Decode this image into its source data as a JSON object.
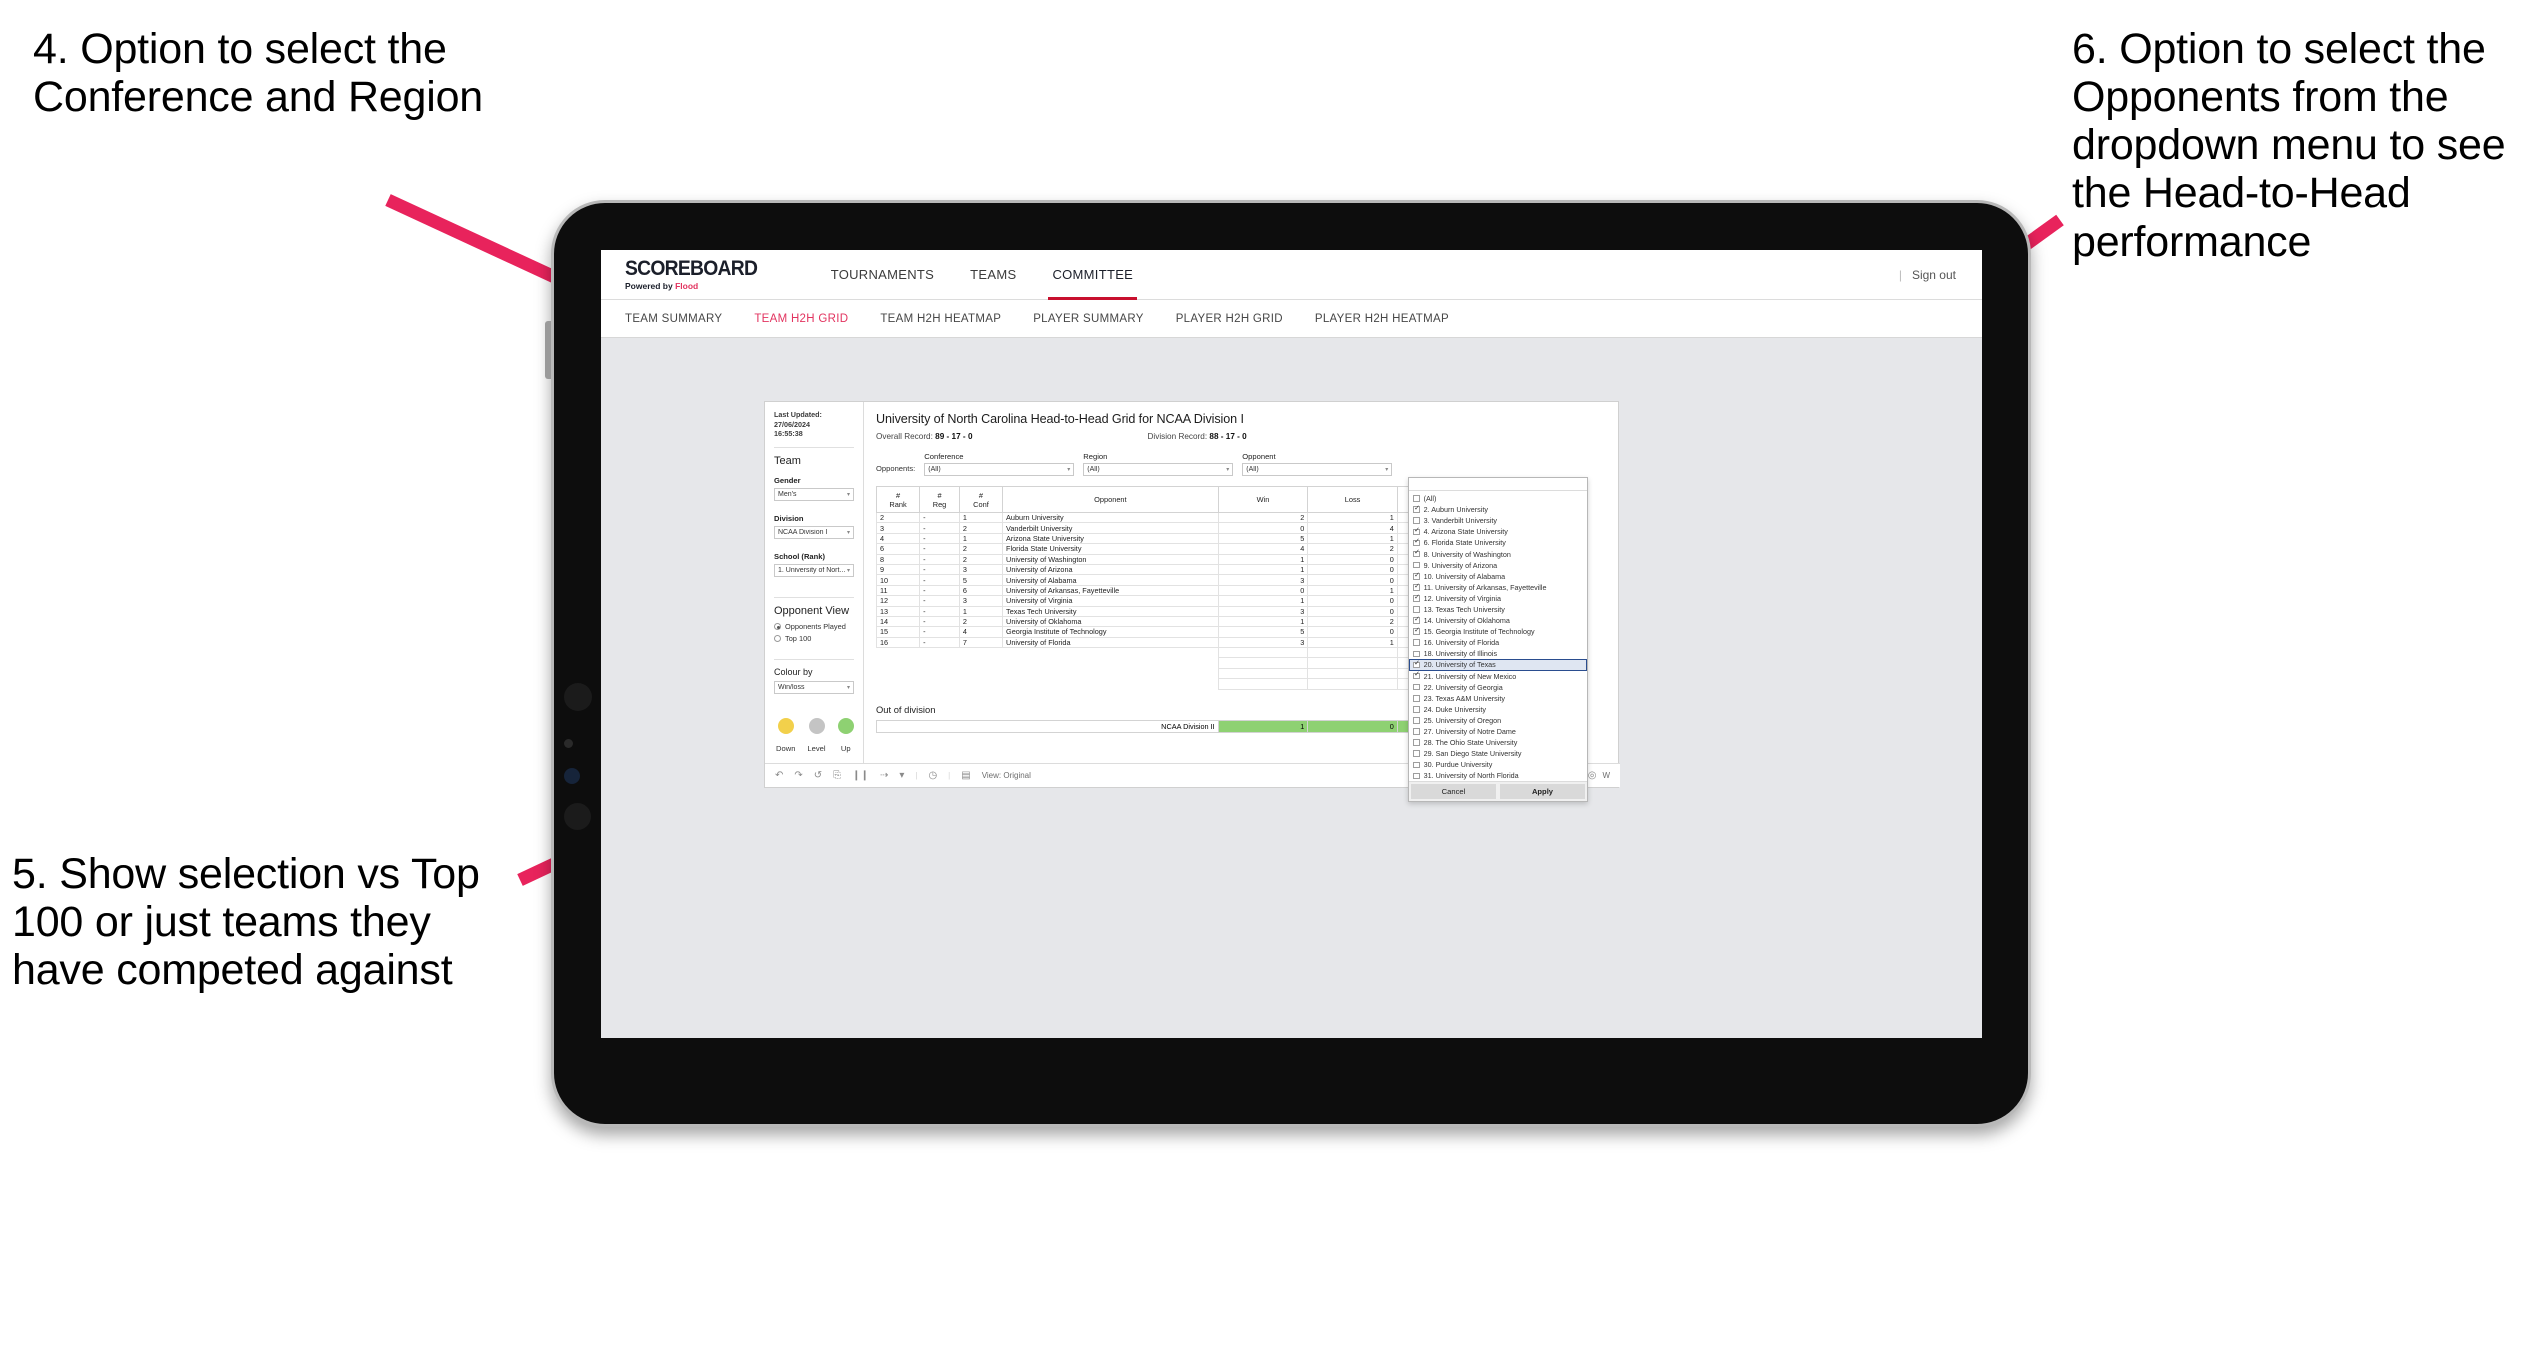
{
  "annotations": [
    {
      "id": "a4",
      "text": "4. Option to select the Conference and Region"
    },
    {
      "id": "a5",
      "text": "5. Show selection vs Top 100 or just teams they have competed against"
    },
    {
      "id": "a6",
      "text": "6. Option to select the Opponents from the dropdown menu to see the Head-to-Head performance"
    }
  ],
  "arrow_color": "#E8235C",
  "app": {
    "brand": {
      "title": "SCOREBOARD",
      "sub_prefix": "Powered by",
      "sub_brand": "Flood"
    },
    "topnav": [
      {
        "label": "TOURNAMENTS",
        "active": false
      },
      {
        "label": "TEAMS",
        "active": false
      },
      {
        "label": "COMMITTEE",
        "active": true
      }
    ],
    "topbar_right": {
      "divider": "|",
      "signout": "Sign out"
    },
    "subnav": [
      {
        "label": "TEAM SUMMARY",
        "active": false
      },
      {
        "label": "TEAM H2H GRID",
        "active": true
      },
      {
        "label": "TEAM H2H HEATMAP",
        "active": false
      },
      {
        "label": "PLAYER SUMMARY",
        "active": false
      },
      {
        "label": "PLAYER H2H GRID",
        "active": false
      },
      {
        "label": "PLAYER H2H HEATMAP",
        "active": false
      }
    ]
  },
  "sidebar": {
    "last_updated": "Last Updated: 27/06/2024",
    "last_updated_time": "16:55:38",
    "team_heading": "Team",
    "gender": {
      "label": "Gender",
      "value": "Men's"
    },
    "division": {
      "label": "Division",
      "value": "NCAA Division I"
    },
    "school": {
      "label": "School (Rank)",
      "value": "1. University of Nort..."
    },
    "opponent_view": {
      "heading": "Opponent View",
      "options": [
        {
          "label": "Opponents Played",
          "selected": true
        },
        {
          "label": "Top 100",
          "selected": false
        }
      ]
    },
    "colour_by": {
      "label": "Colour by",
      "value": "Win/loss"
    },
    "legend": [
      {
        "label": "Down",
        "color": "#F2D04B"
      },
      {
        "label": "Level",
        "color": "#C4C4C4"
      },
      {
        "label": "Up",
        "color": "#8ED172"
      }
    ]
  },
  "sheet": {
    "title": "University of North Carolina Head-to-Head Grid for NCAA Division I",
    "overall_record_label": "Overall Record:",
    "overall_record": "89 - 17 - 0",
    "division_record_label": "Division Record:",
    "division_record": "88 - 17 - 0",
    "opponents_label": "Opponents:",
    "filters": [
      {
        "caption": "Conference",
        "value": "(All)"
      },
      {
        "caption": "Region",
        "value": "(All)"
      },
      {
        "caption": "Opponent",
        "value": "(All)"
      }
    ],
    "columns": [
      "# Rank",
      "# Reg",
      "# Conf",
      "Opponent",
      "Win",
      "Loss",
      ""
    ],
    "rows": [
      {
        "rank": "2",
        "reg": "-",
        "conf": "1",
        "opponent": "Auburn University",
        "win": "2",
        "loss": "1",
        "state": "up"
      },
      {
        "rank": "3",
        "reg": "-",
        "conf": "2",
        "opponent": "Vanderbilt University",
        "win": "0",
        "loss": "4",
        "state": "down"
      },
      {
        "rank": "4",
        "reg": "-",
        "conf": "1",
        "opponent": "Arizona State University",
        "win": "5",
        "loss": "1",
        "state": "up"
      },
      {
        "rank": "6",
        "reg": "-",
        "conf": "2",
        "opponent": "Florida State University",
        "win": "4",
        "loss": "2",
        "state": "up"
      },
      {
        "rank": "8",
        "reg": "-",
        "conf": "2",
        "opponent": "University of Washington",
        "win": "1",
        "loss": "0",
        "state": "up"
      },
      {
        "rank": "9",
        "reg": "-",
        "conf": "3",
        "opponent": "University of Arizona",
        "win": "1",
        "loss": "0",
        "state": "up"
      },
      {
        "rank": "10",
        "reg": "-",
        "conf": "5",
        "opponent": "University of Alabama",
        "win": "3",
        "loss": "0",
        "state": "up"
      },
      {
        "rank": "11",
        "reg": "-",
        "conf": "6",
        "opponent": "University of Arkansas, Fayetteville",
        "win": "0",
        "loss": "1",
        "state": "down"
      },
      {
        "rank": "12",
        "reg": "-",
        "conf": "3",
        "opponent": "University of Virginia",
        "win": "1",
        "loss": "0",
        "state": "up"
      },
      {
        "rank": "13",
        "reg": "-",
        "conf": "1",
        "opponent": "Texas Tech University",
        "win": "3",
        "loss": "0",
        "state": "up"
      },
      {
        "rank": "14",
        "reg": "-",
        "conf": "2",
        "opponent": "University of Oklahoma",
        "win": "1",
        "loss": "2",
        "state": "down"
      },
      {
        "rank": "15",
        "reg": "-",
        "conf": "4",
        "opponent": "Georgia Institute of Technology",
        "win": "5",
        "loss": "0",
        "state": "up"
      },
      {
        "rank": "16",
        "reg": "-",
        "conf": "7",
        "opponent": "University of Florida",
        "win": "3",
        "loss": "1",
        "state": "up"
      }
    ],
    "out_of_division": {
      "title": "Out of division",
      "row": {
        "label": "NCAA Division II",
        "win": "1",
        "loss": "0",
        "state": "up"
      }
    },
    "toolbar": {
      "icons": [
        "undo-icon",
        "redo-icon",
        "revert-icon",
        "refresh-icon",
        "pause-icon",
        "share-icon",
        "caret-down-icon",
        "history-icon",
        "view-icon"
      ],
      "view_label": "View: Original",
      "right_label": "W"
    }
  },
  "opponent_dropdown": {
    "search_value": "",
    "items": [
      {
        "label": "(All)",
        "checked": false,
        "selected": false
      },
      {
        "label": "2. Auburn University",
        "checked": true,
        "selected": false
      },
      {
        "label": "3. Vanderbilt University",
        "checked": false,
        "selected": false
      },
      {
        "label": "4. Arizona State University",
        "checked": true,
        "selected": false
      },
      {
        "label": "6. Florida State University",
        "checked": true,
        "selected": false
      },
      {
        "label": "8. University of Washington",
        "checked": true,
        "selected": false
      },
      {
        "label": "9. University of Arizona",
        "checked": false,
        "selected": false
      },
      {
        "label": "10. University of Alabama",
        "checked": true,
        "selected": false
      },
      {
        "label": "11. University of Arkansas, Fayetteville",
        "checked": true,
        "selected": false
      },
      {
        "label": "12. University of Virginia",
        "checked": true,
        "selected": false
      },
      {
        "label": "13. Texas Tech University",
        "checked": false,
        "selected": false
      },
      {
        "label": "14. University of Oklahoma",
        "checked": true,
        "selected": false
      },
      {
        "label": "15. Georgia Institute of Technology",
        "checked": true,
        "selected": false
      },
      {
        "label": "16. University of Florida",
        "checked": false,
        "selected": false
      },
      {
        "label": "18. University of Illinois",
        "checked": false,
        "selected": false
      },
      {
        "label": "20. University of Texas",
        "checked": true,
        "selected": true
      },
      {
        "label": "21. University of New Mexico",
        "checked": true,
        "selected": false
      },
      {
        "label": "22. University of Georgia",
        "checked": false,
        "selected": false
      },
      {
        "label": "23. Texas A&M University",
        "checked": false,
        "selected": false
      },
      {
        "label": "24. Duke University",
        "checked": false,
        "selected": false
      },
      {
        "label": "25. University of Oregon",
        "checked": false,
        "selected": false
      },
      {
        "label": "27. University of Notre Dame",
        "checked": false,
        "selected": false
      },
      {
        "label": "28. The Ohio State University",
        "checked": false,
        "selected": false
      },
      {
        "label": "29. San Diego State University",
        "checked": false,
        "selected": false
      },
      {
        "label": "30. Purdue University",
        "checked": false,
        "selected": false
      },
      {
        "label": "31. University of North Florida",
        "checked": false,
        "selected": false
      }
    ],
    "cancel_label": "Cancel",
    "apply_label": "Apply"
  }
}
